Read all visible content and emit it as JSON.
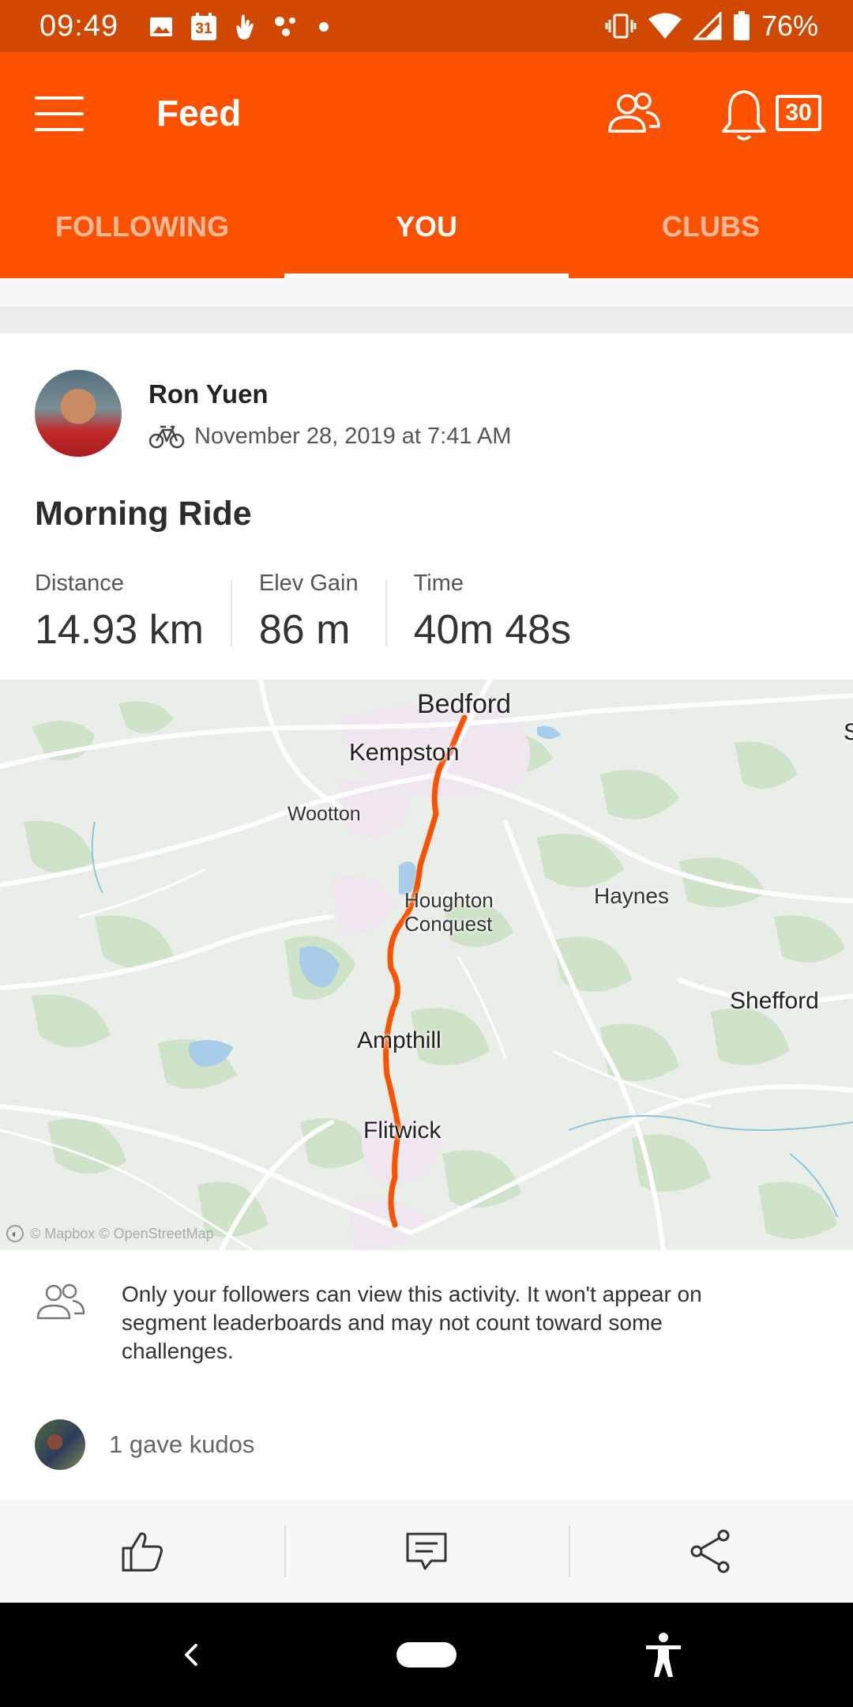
{
  "status_bar": {
    "time": "09:49",
    "calendar_day": "31",
    "battery": "76%",
    "icons": [
      "image-icon",
      "calendar-icon",
      "hand-icon",
      "dots-icon",
      "dot-icon",
      "vibrate-icon",
      "wifi-icon",
      "signal-icon",
      "battery-icon"
    ]
  },
  "app_bar": {
    "title": "Feed",
    "notification_count": "30",
    "tabs": [
      {
        "label": "FOLLOWING",
        "active": false
      },
      {
        "label": "YOU",
        "active": true
      },
      {
        "label": "CLUBS",
        "active": false
      }
    ]
  },
  "activity": {
    "athlete_name": "Ron Yuen",
    "sport_icon": "bike-icon",
    "datetime": "November 28, 2019 at 7:41 AM",
    "title": "Morning Ride",
    "stats": [
      {
        "label": "Distance",
        "value": "14.93 km"
      },
      {
        "label": "Elev Gain",
        "value": "86 m"
      },
      {
        "label": "Time",
        "value": "40m 48s"
      }
    ],
    "map": {
      "place_labels": [
        "Bedford",
        "Kempston",
        "Wootton",
        "Houghton",
        "Conquest",
        "Haynes",
        "Shefford",
        "Ampthill",
        "Flitwick",
        "S"
      ],
      "attribution": "© Mapbox © OpenStreetMap",
      "route_color": "#fc5200"
    },
    "privacy_notice": "Only your followers can view this activity. It won't appear on segment leaderboards and may not count toward some challenges.",
    "kudos_text": "1 gave kudos",
    "actions": [
      "kudos-icon",
      "comment-icon",
      "share-icon"
    ]
  },
  "colors": {
    "brand": "#fc5200",
    "status_bar": "#d14800"
  }
}
